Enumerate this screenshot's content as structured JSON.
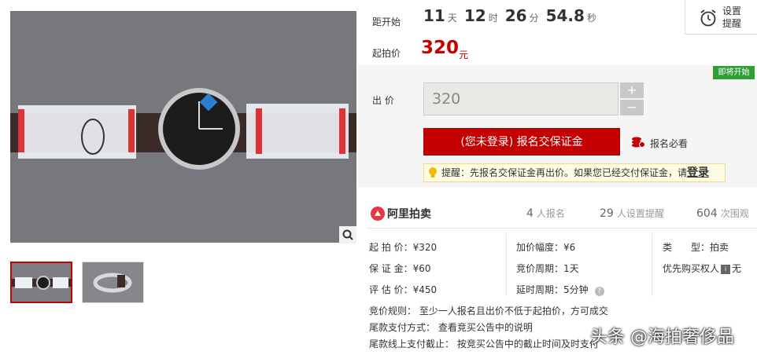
{
  "countdown": {
    "label": "距开始",
    "days": "11",
    "days_unit": "天",
    "hours": "12",
    "hours_unit": "时",
    "minutes": "26",
    "minutes_unit": "分",
    "seconds": "54.8",
    "seconds_unit": "秒"
  },
  "start_price": {
    "label": "起拍价",
    "value": "320",
    "unit": "元"
  },
  "remind": {
    "label": "设置提醒",
    "icon": "alarm-clock-icon"
  },
  "bid": {
    "status_tag": "即将开始",
    "label": "出 价",
    "input_value": "320",
    "plus": "+",
    "minus": "−",
    "signup_button": "(您未登录) 报名交保证金",
    "notice_link": "报名必看",
    "tip_text": "提醒：先报名交保证金再出价。如果您已经交付保证金，请",
    "tip_login": "登录"
  },
  "stats": {
    "logo_text": "阿里拍卖",
    "signups_num": "4",
    "signups_label": "人报名",
    "reminders_num": "29",
    "reminders_label": "人设置提醒",
    "views_num": "604",
    "views_label": "次围观"
  },
  "info": {
    "start_price": "起 拍 价：¥320",
    "deposit": "保 证 金：¥60",
    "appraisal": "评 估 价：¥450",
    "increment": "加价幅度：¥6",
    "cycle": "竞价周期：1天",
    "delay": "延时周期：5分钟",
    "type_label": "类　　型：",
    "type_value": "拍卖",
    "priority_label": "优先购买权人",
    "priority_value": "无",
    "help_icon": "?"
  },
  "rules": {
    "bid_rule": "竞价规则：  至少一人报名且出价不低于起拍价，方可成交",
    "payment": "尾款支付方式：  查看竞买公告中的说明",
    "deadline": "尾款线上支付截止：  按竞买公告中的截止时间及时支付"
  },
  "watermark": "头条 @海拍奢侈品",
  "colors": {
    "accent": "#c40000",
    "status_green": "#2f9e35"
  }
}
